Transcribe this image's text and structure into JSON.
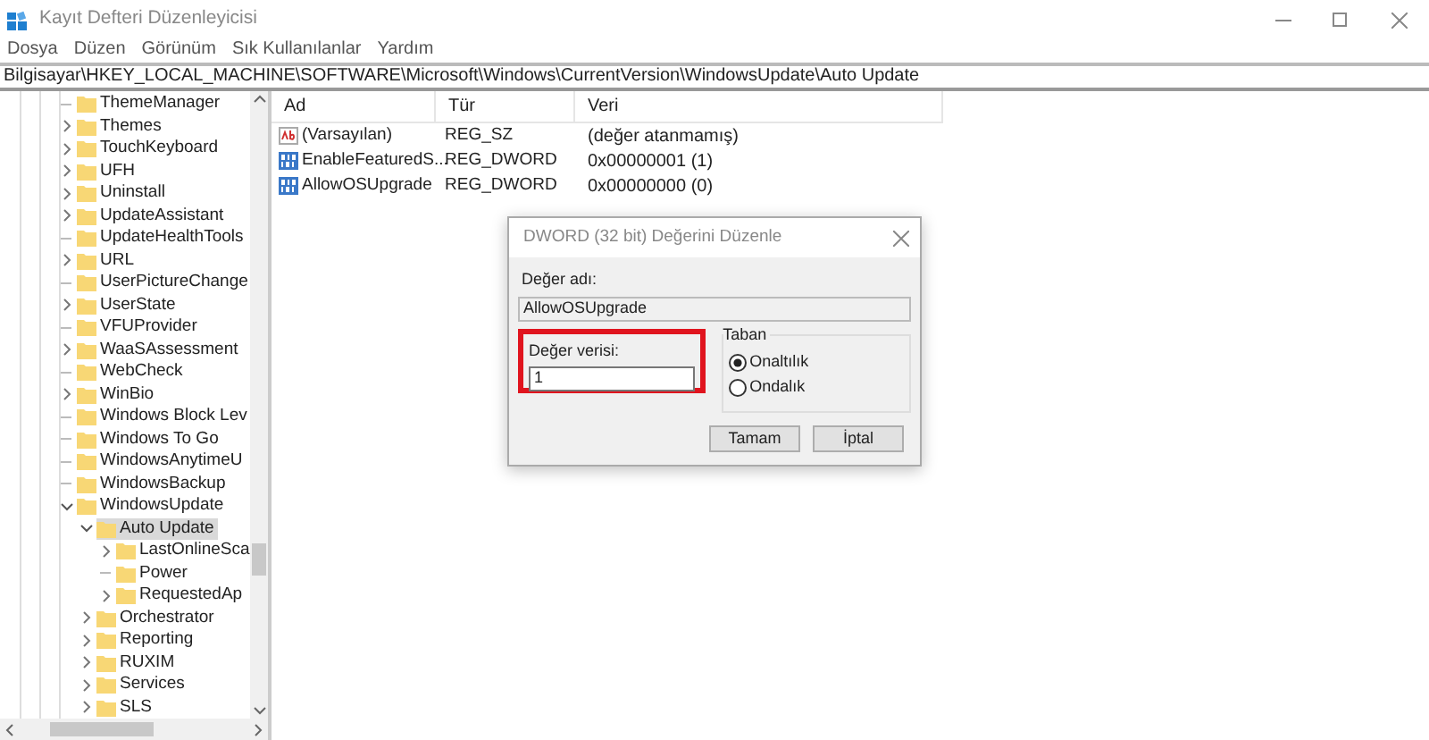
{
  "window": {
    "title": "Kayıt Defteri Düzenleyicisi"
  },
  "menu": [
    "Dosya",
    "Düzen",
    "Görünüm",
    "Sık Kullanılanlar",
    "Yardım"
  ],
  "address": "Bilgisayar\\HKEY_LOCAL_MACHINE\\SOFTWARE\\Microsoft\\Windows\\CurrentVersion\\WindowsUpdate\\Auto Update",
  "tree": {
    "items": [
      {
        "label": "ThemeManager",
        "expandable": false,
        "selected": false
      },
      {
        "label": "Themes",
        "expandable": true,
        "expanded": false,
        "selected": false
      },
      {
        "label": "TouchKeyboard",
        "expandable": true,
        "expanded": false,
        "selected": false
      },
      {
        "label": "UFH",
        "expandable": true,
        "expanded": false,
        "selected": false
      },
      {
        "label": "Uninstall",
        "expandable": true,
        "expanded": false,
        "selected": false
      },
      {
        "label": "UpdateAssistant",
        "expandable": true,
        "expanded": false,
        "selected": false
      },
      {
        "label": "UpdateHealthTools",
        "expandable": false,
        "selected": false
      },
      {
        "label": "URL",
        "expandable": true,
        "expanded": false,
        "selected": false
      },
      {
        "label": "UserPictureChange",
        "expandable": false,
        "selected": false
      },
      {
        "label": "UserState",
        "expandable": true,
        "expanded": false,
        "selected": false
      },
      {
        "label": "VFUProvider",
        "expandable": false,
        "selected": false
      },
      {
        "label": "WaaSAssessment",
        "expandable": true,
        "expanded": false,
        "selected": false
      },
      {
        "label": "WebCheck",
        "expandable": false,
        "selected": false
      },
      {
        "label": "WinBio",
        "expandable": true,
        "expanded": false,
        "selected": false
      },
      {
        "label": "Windows Block Lev",
        "expandable": false,
        "selected": false
      },
      {
        "label": "Windows To Go",
        "expandable": false,
        "selected": false
      },
      {
        "label": "WindowsAnytimeU",
        "expandable": false,
        "selected": false
      },
      {
        "label": "WindowsBackup",
        "expandable": false,
        "selected": false
      },
      {
        "label": "WindowsUpdate",
        "expandable": true,
        "expanded": true,
        "selected": false,
        "children": [
          {
            "label": "Auto Update",
            "expandable": true,
            "expanded": true,
            "selected": true,
            "children": [
              {
                "label": "LastOnlineSca",
                "expandable": true,
                "expanded": false,
                "selected": false
              },
              {
                "label": "Power",
                "expandable": false,
                "selected": false
              },
              {
                "label": "RequestedAp",
                "expandable": true,
                "expanded": false,
                "selected": false
              }
            ]
          },
          {
            "label": "Orchestrator",
            "expandable": true,
            "expanded": false,
            "selected": false
          },
          {
            "label": "Reporting",
            "expandable": true,
            "expanded": false,
            "selected": false
          },
          {
            "label": "RUXIM",
            "expandable": true,
            "expanded": false,
            "selected": false
          },
          {
            "label": "Services",
            "expandable": true,
            "expanded": false,
            "selected": false
          },
          {
            "label": "SLS",
            "expandable": true,
            "expanded": false,
            "selected": false
          }
        ]
      }
    ]
  },
  "values": {
    "columns": [
      "Ad",
      "Tür",
      "Veri"
    ],
    "rows": [
      {
        "kind": "string",
        "name": "(Varsayılan)",
        "type": "REG_SZ",
        "data": "(değer atanmamış)"
      },
      {
        "kind": "dword",
        "name": "EnableFeaturedS...",
        "type": "REG_DWORD",
        "data": "0x00000001 (1)"
      },
      {
        "kind": "dword",
        "name": "AllowOSUpgrade",
        "type": "REG_DWORD",
        "data": "0x00000000 (0)"
      }
    ]
  },
  "dialog": {
    "title": "DWORD (32 bit) Değerini Düzenle",
    "name_label": "Değer adı:",
    "name_value": "AllowOSUpgrade",
    "data_label": "Değer verisi:",
    "data_value": "1",
    "data_highlighted": true,
    "base": {
      "label": "Taban",
      "options": [
        {
          "label": "Onaltılık",
          "selected": true
        },
        {
          "label": "Ondalık",
          "selected": false
        }
      ]
    },
    "buttons": [
      "Tamam",
      "İptal"
    ]
  }
}
